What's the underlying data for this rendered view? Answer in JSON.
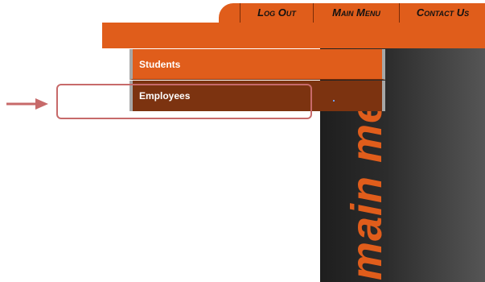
{
  "topnav": {
    "logout_label": "Log Out",
    "main_menu_label": "Main Menu",
    "contact_label": "Contact Us"
  },
  "menu": {
    "items": [
      {
        "label": "Students"
      },
      {
        "label": "Employees"
      }
    ]
  },
  "sidebar": {
    "vertical_text": "main me"
  },
  "colors": {
    "accent": "#e05d1b",
    "accent_dark": "#7c3310",
    "annotation": "#c76a6a"
  }
}
